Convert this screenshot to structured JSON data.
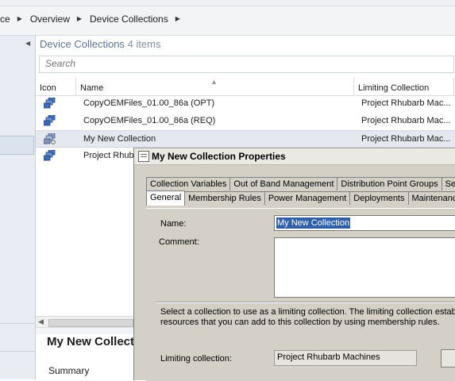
{
  "breadcrumb": {
    "items": [
      "ce",
      "Overview",
      "Device Collections"
    ]
  },
  "list": {
    "title": "Device Collections",
    "count": "4 items",
    "search_placeholder": "Search",
    "columns": [
      "Icon",
      "Name",
      "Limiting Collection"
    ],
    "rows": [
      {
        "name": "CopyOEMFiles_01.00_86a (OPT)",
        "limiting": "Project Rhubarb Mac..."
      },
      {
        "name": "CopyOEMFiles_01.00_86a (REQ)",
        "limiting": "Project Rhubarb Mac..."
      },
      {
        "name": "My New Collection",
        "limiting": "Project Rhubarb Mac..."
      },
      {
        "name": "Project Rhub",
        "limiting": ""
      }
    ],
    "selected_row": "My New Collection"
  },
  "details": {
    "title": "My New Collect",
    "summary_label": "Summary"
  },
  "dialog": {
    "title": "My New Collection Properties",
    "tabs_row1": [
      "Collection Variables",
      "Out of Band Management",
      "Distribution Point Groups",
      "Sec"
    ],
    "tabs_row2": [
      "General",
      "Membership Rules",
      "Power Management",
      "Deployments",
      "Maintenanc"
    ],
    "active_tab": "General",
    "name_label": "Name:",
    "name_value": "My New Collection",
    "comment_label": "Comment:",
    "comment_value": "",
    "description_line1": "Select a collection to use as a limiting collection. The limiting collection establis",
    "description_line2": "resources that you can add to this collection by using membership rules.",
    "limiting_label": "Limiting collection:",
    "limiting_value": "Project Rhubarb Machines"
  },
  "icons": {
    "collection": "device-collection-icon",
    "collection_selected": "device-collection-new-icon",
    "dialog": "properties-window-icon"
  },
  "colors": {
    "title_text": "#5d7396",
    "selection_highlight": "#2f5fa7",
    "dialog_bg": "#d4d0c8"
  }
}
